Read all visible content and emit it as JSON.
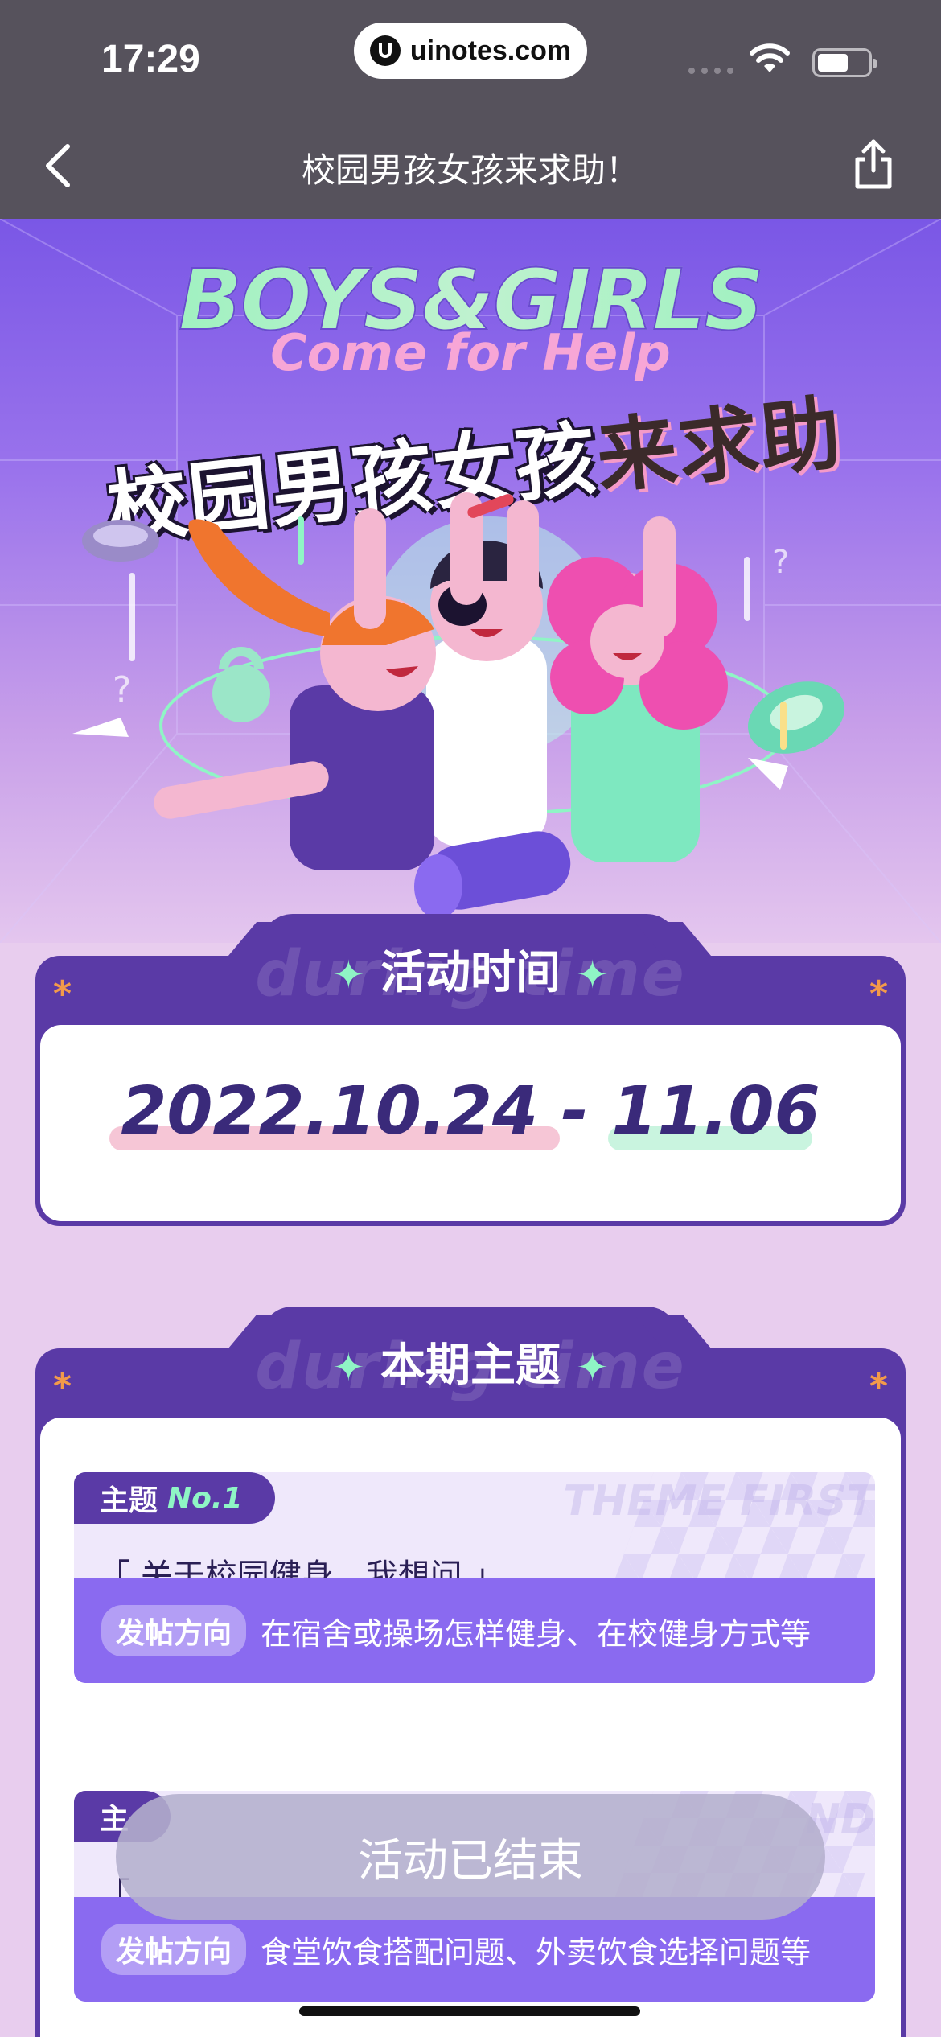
{
  "status": {
    "time": "17:29",
    "url": "uinotes.com"
  },
  "nav": {
    "title": "校园男孩女孩来求助！"
  },
  "hero": {
    "en_line1": "BOYS&GIRLS",
    "en_line2": "Come for Help",
    "cn_title_main": "校园男孩女孩",
    "cn_title_accent": "来求助"
  },
  "activity_time": {
    "ghost": "during time",
    "title": "活动时间",
    "start": "2022.10.24",
    "separator": "-",
    "end": "11.06"
  },
  "themes_section": {
    "ghost": "during time",
    "title": "本期主题",
    "items": [
      {
        "label": "主题",
        "num": "No.1",
        "watermark": "THEME FIRST",
        "question": "「 关于校园健身，我想问 」",
        "dir_label": "发帖方向",
        "dir_text": "在宿舍或操场怎样健身、在校健身方式等"
      },
      {
        "label": "主",
        "num": "",
        "watermark": "ND",
        "question": "「 ",
        "dir_label": "发帖方向",
        "dir_text": "食堂饮食搭配问题、外卖饮食选择问题等"
      }
    ]
  },
  "ended_button": {
    "label": "活动已结束"
  },
  "colors": {
    "primary": "#5a3aa6",
    "accent_green": "#8ff5c5",
    "accent_orange": "#f39a4a"
  }
}
